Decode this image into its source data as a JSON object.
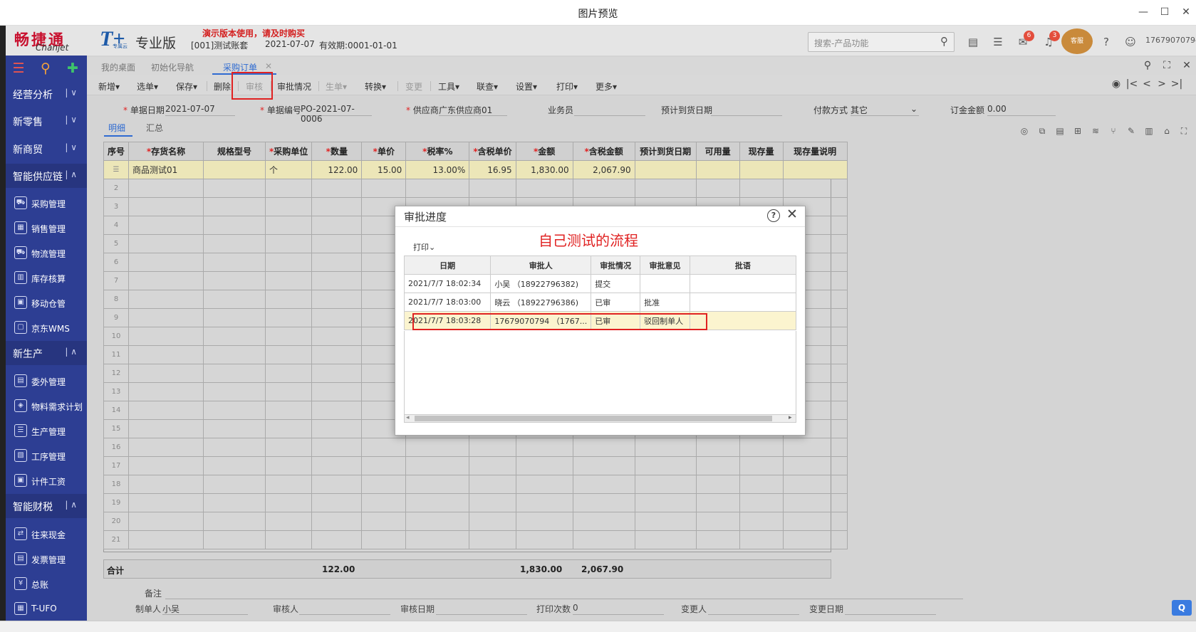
{
  "window": {
    "title": "图片预览"
  },
  "header": {
    "logo_cn": "畅捷通",
    "logo_en": "Chanjet",
    "product_logo": "T+",
    "product_sub": "专属云",
    "edition": "专业版",
    "demo_notice": "演示版本使用，请及时购买",
    "account": "[001]测试账套",
    "account_date": "2021-07-07",
    "valid_label": "有效期:0001-01-01",
    "search_placeholder": "搜索-产品功能",
    "badge_msg": "6",
    "badge_bell": "3",
    "service_label": "客服",
    "user": "17679070794"
  },
  "sidebar": {
    "sections": [
      {
        "label": "经营分析"
      },
      {
        "label": "新零售"
      },
      {
        "label": "新商贸"
      },
      {
        "label": "智能供应链"
      },
      {
        "label": "新生产"
      },
      {
        "label": "智能财税"
      }
    ],
    "supply_items": [
      "采购管理",
      "销售管理",
      "物流管理",
      "库存核算",
      "移动仓管",
      "京东WMS"
    ],
    "production_items": [
      "委外管理",
      "物料需求计划",
      "生产管理",
      "工序管理",
      "计件工资"
    ],
    "finance_items": [
      "往来现金",
      "发票管理",
      "总账",
      "T-UFO"
    ]
  },
  "tabs": [
    "我的桌面",
    "初始化导航",
    "采购订单"
  ],
  "toolbar": {
    "new": "新增",
    "select": "选单",
    "save": "保存",
    "delete": "删除",
    "audit": "审核",
    "approval": "审批情况",
    "gen": "生单",
    "convert": "转换",
    "change": "变更",
    "tools": "工具",
    "link": "联查",
    "settings": "设置",
    "print": "打印",
    "more": "更多"
  },
  "form": {
    "date_label": "单据日期",
    "date_value": "2021-07-07",
    "no_label": "单据编号",
    "no_value": "PO-2021-07-0006",
    "supplier_label": "供应商",
    "supplier_value": "广东供应商01",
    "clerk_label": "业务员",
    "arrival_label": "预计到货日期",
    "pay_label": "付款方式",
    "pay_value": "其它",
    "deposit_label": "订金金额",
    "deposit_value": "0.00"
  },
  "subtabs": [
    "明细",
    "汇总"
  ],
  "grid": {
    "columns": [
      "序号",
      "存货名称",
      "规格型号",
      "采购单位",
      "数量",
      "单价",
      "税率%",
      "含税单价",
      "金额",
      "含税金额",
      "预计到货日期",
      "可用量",
      "现存量",
      "现存量说明"
    ],
    "row1": {
      "name": "商品测试01",
      "unit": "个",
      "qty": "122.00",
      "price": "15.00",
      "tax": "13.00%",
      "tax_price": "16.95",
      "amount": "1,830.00",
      "tax_amount": "2,067.90"
    },
    "row_numbers": [
      "2",
      "3",
      "4",
      "5",
      "6",
      "7",
      "8",
      "9",
      "10",
      "11",
      "12",
      "13",
      "14",
      "15",
      "16",
      "17",
      "18",
      "19",
      "20",
      "21"
    ],
    "sum_label": "合计",
    "sum_qty": "122.00",
    "sum_amount": "1,830.00",
    "sum_tax_amount": "2,067.90"
  },
  "footer": {
    "remark": "备注",
    "maker_label": "制单人",
    "maker_value": "小吴",
    "auditor_label": "审核人",
    "audit_date_label": "审核日期",
    "print_count_label": "打印次数",
    "print_count_value": "0",
    "changer_label": "变更人",
    "change_date_label": "变更日期"
  },
  "dialog": {
    "title": "审批进度",
    "annotation": "自己测试的流程",
    "print": "打印",
    "columns": [
      "日期",
      "审批人",
      "审批情况",
      "审批意见",
      "批语"
    ],
    "rows": [
      {
        "date": "2021/7/7 18:02:34",
        "approver": "小吴 （18922796382)",
        "status": "提交",
        "opinion": "",
        "comment": ""
      },
      {
        "date": "2021/7/7 18:03:00",
        "approver": "晓云 （18922796386)",
        "status": "已审",
        "opinion": "批准",
        "comment": ""
      },
      {
        "date": "2021/7/7 18:03:28",
        "approver": "17679070794 （1767...",
        "status": "已审",
        "opinion": "驳回制单人",
        "comment": ""
      }
    ]
  },
  "colors": {
    "sidebar": "#2d3e93",
    "accent": "#2f6bd1",
    "alert": "#e02222",
    "selected_row": "#ece6b8"
  }
}
